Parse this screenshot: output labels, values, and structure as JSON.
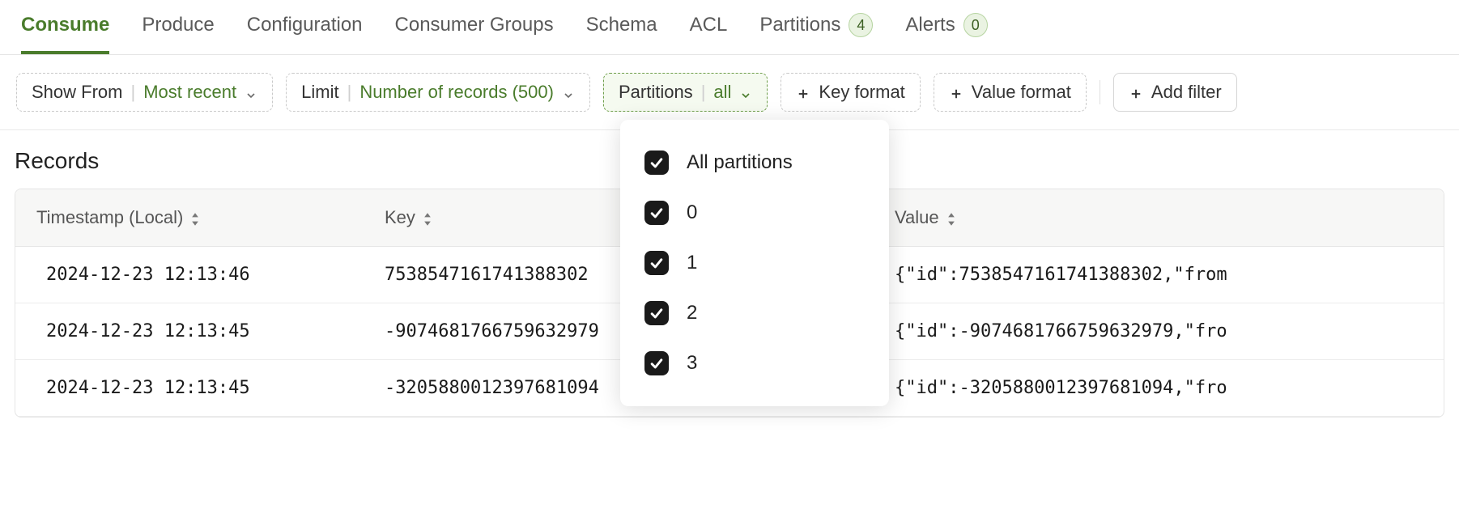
{
  "tabs": [
    {
      "label": "Consume",
      "active": true
    },
    {
      "label": "Produce"
    },
    {
      "label": "Configuration"
    },
    {
      "label": "Consumer Groups"
    },
    {
      "label": "Schema"
    },
    {
      "label": "ACL"
    },
    {
      "label": "Partitions",
      "badge": "4"
    },
    {
      "label": "Alerts",
      "badge": "0"
    }
  ],
  "filters": {
    "show_from": {
      "label": "Show From",
      "value": "Most recent"
    },
    "limit": {
      "label": "Limit",
      "value": "Number of records (500)"
    },
    "partitions": {
      "label": "Partitions",
      "value": "all"
    },
    "key_format": {
      "label": "Key format"
    },
    "value_format": {
      "label": "Value format"
    },
    "add_filter": {
      "label": "Add filter"
    }
  },
  "section_title": "Records",
  "table": {
    "columns": {
      "timestamp": "Timestamp (Local)",
      "key": "Key",
      "value": "Value"
    },
    "rows": [
      {
        "ts": "2024-12-23 12:13:46",
        "key": "7538547161741388302",
        "value": "{\"id\":7538547161741388302,\"from"
      },
      {
        "ts": "2024-12-23 12:13:45",
        "key": "-9074681766759632979",
        "value": "{\"id\":-9074681766759632979,\"fro"
      },
      {
        "ts": "2024-12-23 12:13:45",
        "key": "-3205880012397681094",
        "value": "{\"id\":-3205880012397681094,\"fro"
      }
    ]
  },
  "partitions_dropdown": {
    "all_label": "All partitions",
    "options": [
      "0",
      "1",
      "2",
      "3"
    ]
  }
}
